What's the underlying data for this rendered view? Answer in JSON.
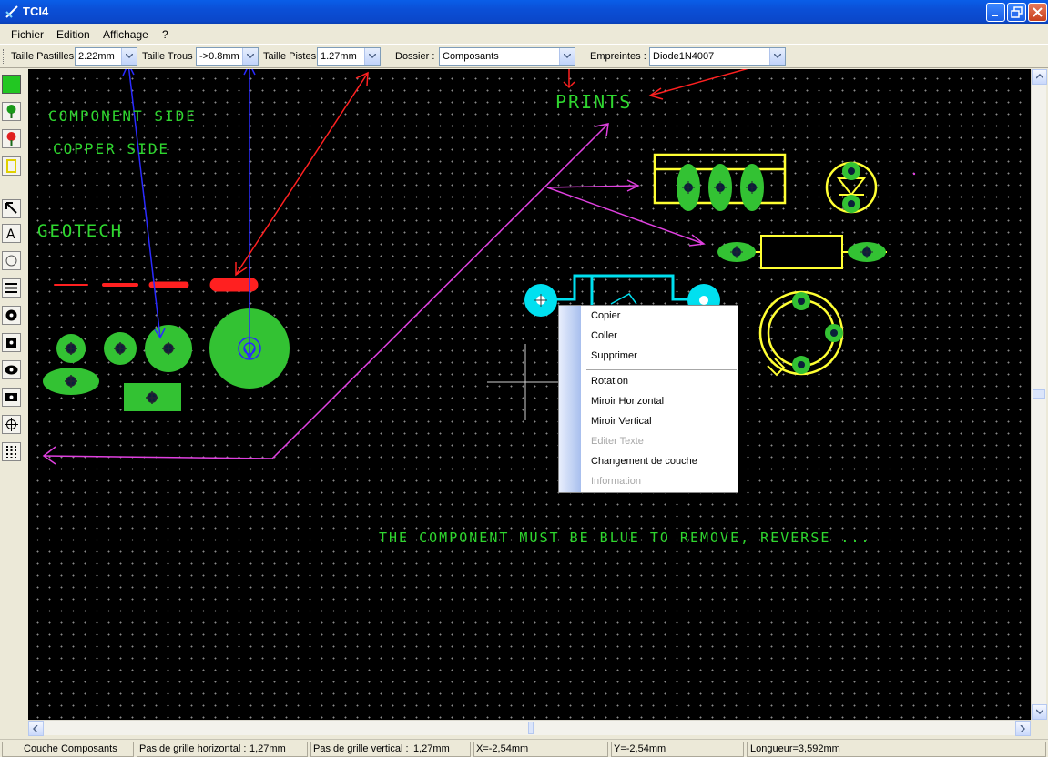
{
  "window": {
    "title": "TCI4"
  },
  "menubar": [
    "Fichier",
    "Edition",
    "Affichage",
    "?"
  ],
  "toolbar": {
    "pads_label": "Taille Pastilles",
    "pads_value": "2.22mm",
    "holes_label": "Taille Trous",
    "holes_value": "->0.8mm",
    "tracks_label": "Taille Pistes",
    "tracks_value": "1.27mm",
    "folder_label": "Dossier :",
    "folder_value": "Composants",
    "footprints_label": "Empreintes :",
    "footprints_value": "Diode1N4007"
  },
  "canvas": {
    "annotations": {
      "component_side": "COMPONENT SIDE",
      "copper_side": "COPPER SIDE",
      "geotech": "GEOTECH",
      "prints": "PRINTS",
      "note": "THE COMPONENT MUST BE BLUE TO REMOVE, REVERSE ..."
    },
    "colors": {
      "background": "#000000",
      "pad_green": "#33c233",
      "red": "#ff2020",
      "yellow": "#ffff33",
      "cyan": "#00e0f0",
      "magenta": "#e040e0",
      "blue": "#2a2aff"
    }
  },
  "context_menu": {
    "group1": [
      "Copier",
      "Coller",
      "Supprimer"
    ],
    "group2": [
      "Rotation",
      "Miroir Horizontal",
      "Miroir Vertical",
      "Editer Texte",
      "Changement de couche",
      "Information"
    ],
    "disabled": [
      "Editer Texte",
      "Information"
    ]
  },
  "statusbar": {
    "layer": "Couche Composants",
    "hgrid_label": "Pas de grille horizontal :",
    "hgrid_value": "1,27mm",
    "vgrid_label": "Pas de grille vertical :",
    "vgrid_value": "1,27mm",
    "x": "X=-2,54mm",
    "y": "Y=-2,54mm",
    "length": "Longueur=3,592mm"
  },
  "tools": [
    "layer-green-icon",
    "component-pad-icon",
    "copper-pad-icon",
    "select-layer-icon",
    "pointer-icon",
    "text-icon",
    "circle-icon",
    "track-icon",
    "round-pad-icon",
    "square-pad-icon",
    "oval-pad-icon",
    "rect-pad-icon",
    "target-icon",
    "connector-icon"
  ]
}
